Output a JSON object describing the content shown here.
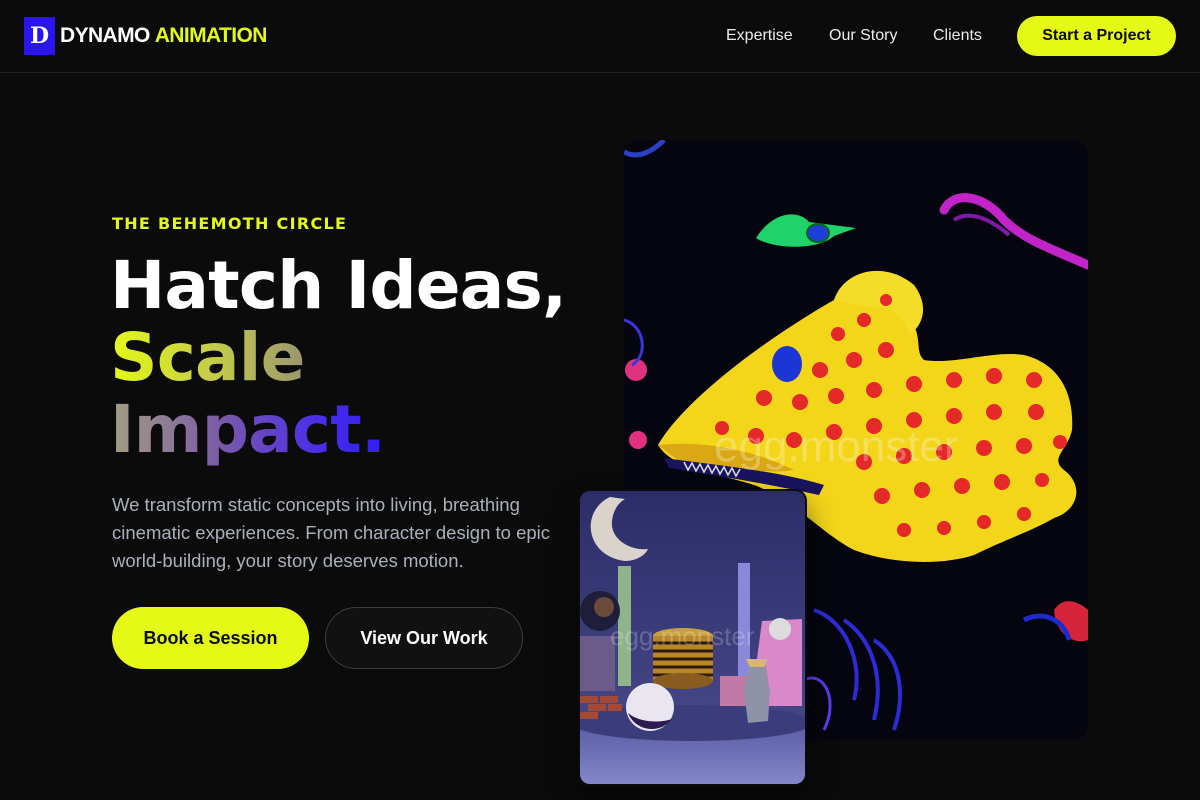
{
  "header": {
    "logo_letter": "D",
    "brand_word_1": "DYNAMO",
    "brand_word_2": "ANIMATION",
    "nav": [
      {
        "label": "Expertise"
      },
      {
        "label": "Our Story"
      },
      {
        "label": "Clients"
      }
    ],
    "cta_label": "Start a Project"
  },
  "hero": {
    "eyebrow": "THE BEHEMOTH CIRCLE",
    "headline_line_1": "Hatch Ideas,",
    "headline_line_2": "Scale",
    "headline_line_3": "Impact.",
    "lead": "We transform static concepts into living, breathing cinematic experiences. From character design to epic world-building, your story deserves motion.",
    "primary_button": "Book a Session",
    "secondary_button": "View Our Work"
  },
  "media": {
    "main_watermark": "egg.monster",
    "thumb_watermark": "egg.monster"
  },
  "colors": {
    "background": "#0b0b0b",
    "accent_yellow": "#e4fa16",
    "accent_blue": "#2a14f0",
    "muted_text": "#aab0ba"
  }
}
